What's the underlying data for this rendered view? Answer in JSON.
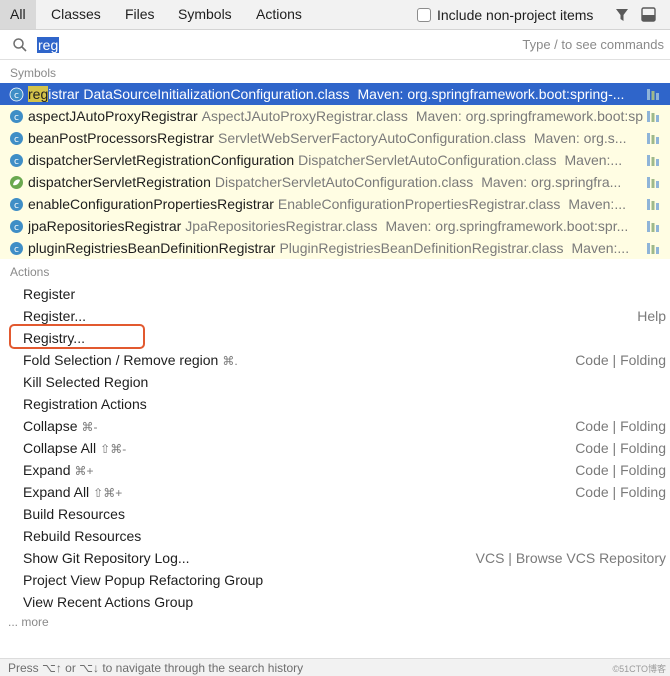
{
  "tabs": [
    {
      "label": "All",
      "active": true
    },
    {
      "label": "Classes",
      "active": false
    },
    {
      "label": "Files",
      "active": false
    },
    {
      "label": "Symbols",
      "active": false
    },
    {
      "label": "Actions",
      "active": false
    }
  ],
  "include_non_project": {
    "label": "Include non-project items",
    "checked": false
  },
  "search": {
    "value": "reg",
    "hint": "Type / to see commands"
  },
  "symbols_section": {
    "label": "Symbols"
  },
  "symbols": [
    {
      "match": "reg",
      "name_rest": "istrar",
      "class": "DataSourceInitializationConfiguration.class",
      "maven": "Maven: org.springframework.boot:spring-...",
      "icon": "class-icon",
      "selected": true
    },
    {
      "match": "",
      "name_rest": "aspectJAutoProxyRegistrar",
      "class": "AspectJAutoProxyRegistrar.class",
      "maven": "Maven: org.springframework.boot:spr...",
      "icon": "class-icon",
      "selected": false
    },
    {
      "match": "",
      "name_rest": "beanPostProcessorsRegistrar",
      "class": "ServletWebServerFactoryAutoConfiguration.class",
      "maven": "Maven: org.s...",
      "icon": "class-icon",
      "selected": false
    },
    {
      "match": "",
      "name_rest": "dispatcherServletRegistrationConfiguration",
      "class": "DispatcherServletAutoConfiguration.class",
      "maven": "Maven:...",
      "icon": "class-icon",
      "selected": false
    },
    {
      "match": "",
      "name_rest": "dispatcherServletRegistration",
      "class": "DispatcherServletAutoConfiguration.class",
      "maven": "Maven: org.springfra...",
      "icon": "bean-icon",
      "selected": false
    },
    {
      "match": "",
      "name_rest": "enableConfigurationPropertiesRegistrar",
      "class": "EnableConfigurationPropertiesRegistrar.class",
      "maven": "Maven:...",
      "icon": "class-icon",
      "selected": false
    },
    {
      "match": "",
      "name_rest": "jpaRepositoriesRegistrar",
      "class": "JpaRepositoriesRegistrar.class",
      "maven": "Maven: org.springframework.boot:spr...",
      "icon": "class-icon",
      "selected": false
    },
    {
      "match": "",
      "name_rest": "pluginRegistriesBeanDefinitionRegistrar",
      "class": "PluginRegistriesBeanDefinitionRegistrar.class",
      "maven": "Maven:...",
      "icon": "class-icon",
      "selected": false
    }
  ],
  "actions_section": {
    "label": "Actions"
  },
  "actions": [
    {
      "name": "Register",
      "shortcut": "",
      "right": ""
    },
    {
      "name": "Register...",
      "shortcut": "",
      "right": "Help"
    },
    {
      "name": "Registry...",
      "shortcut": "",
      "right": ""
    },
    {
      "name": "Fold Selection / Remove region",
      "shortcut": "⌘.",
      "right": "Code | Folding"
    },
    {
      "name": "Kill Selected Region",
      "shortcut": "",
      "right": ""
    },
    {
      "name": "Registration Actions",
      "shortcut": "",
      "right": ""
    },
    {
      "name": "Collapse",
      "shortcut": "⌘-",
      "right": "Code | Folding"
    },
    {
      "name": "Collapse All",
      "shortcut": "⇧⌘-",
      "right": "Code | Folding"
    },
    {
      "name": "Expand",
      "shortcut": "⌘+",
      "right": "Code | Folding"
    },
    {
      "name": "Expand All",
      "shortcut": "⇧⌘+",
      "right": "Code | Folding"
    },
    {
      "name": "Build Resources",
      "shortcut": "",
      "right": ""
    },
    {
      "name": "Rebuild Resources",
      "shortcut": "",
      "right": ""
    },
    {
      "name": "Show Git Repository Log...",
      "shortcut": "",
      "right": "VCS | Browse VCS Repository"
    },
    {
      "name": "Project View Popup Refactoring Group",
      "shortcut": "",
      "right": ""
    },
    {
      "name": "View Recent Actions Group",
      "shortcut": "",
      "right": ""
    }
  ],
  "more_label": "... more",
  "status": {
    "text": "Press ⌥↑ or ⌥↓ to navigate through the search history"
  },
  "watermark": "©51CTO博客",
  "colors": {
    "selection": "#2f65ca",
    "match_highlight": "#d4c34a",
    "annotation_box": "#e2592f",
    "symbol_row_bg": "#fffde3"
  }
}
